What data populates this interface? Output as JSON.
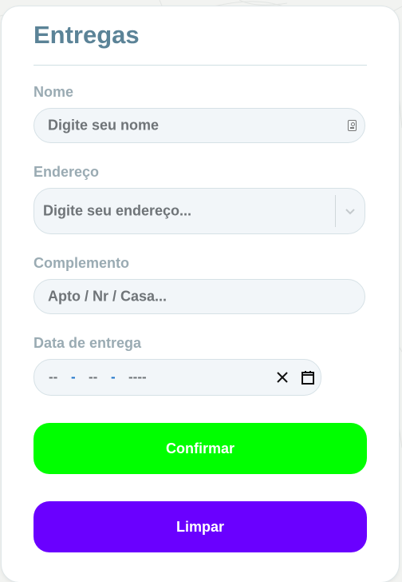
{
  "form": {
    "title": "Entregas",
    "name": {
      "label": "Nome",
      "placeholder": "Digite seu nome"
    },
    "address": {
      "label": "Endereço",
      "placeholder": "Digite seu endereço..."
    },
    "complement": {
      "label": "Complemento",
      "placeholder": "Apto / Nr / Casa..."
    },
    "date": {
      "label": "Data de entrega",
      "day": "--",
      "month": "--",
      "year": "----",
      "separator": "-"
    },
    "confirm_label": "Confirmar",
    "clear_label": "Limpar"
  },
  "colors": {
    "title": "#5b8397",
    "label": "#9aabb3",
    "confirm": "#00ff00",
    "clear": "#6a00ff"
  },
  "icons": {
    "name_field": "contact-card-icon",
    "address_field": "chevron-down-icon",
    "date_clear": "close-icon",
    "date_picker": "calendar-icon"
  }
}
